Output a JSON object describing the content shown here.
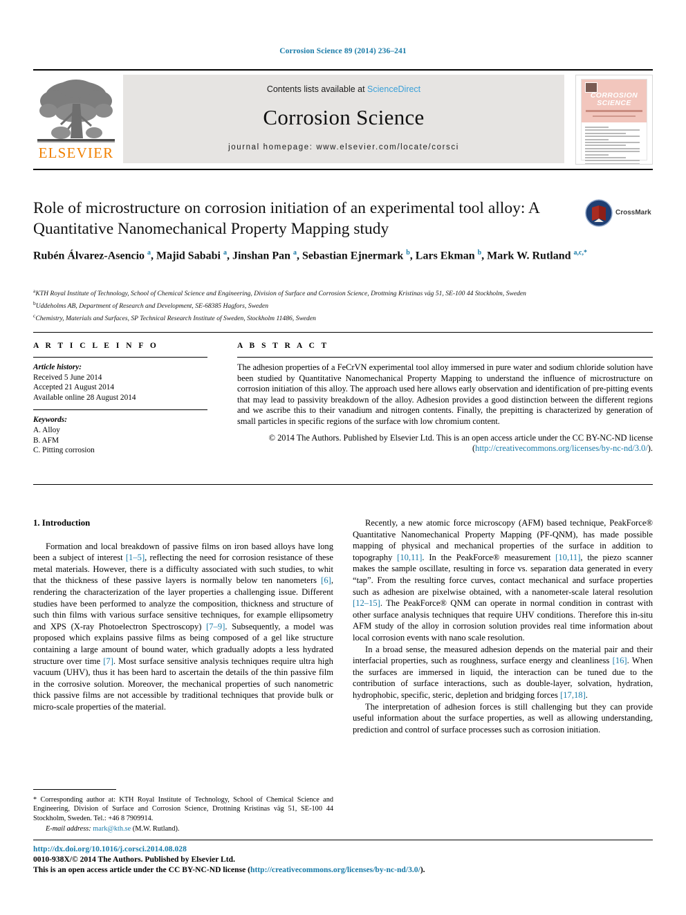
{
  "running_head": "Corrosion Science 89 (2014) 236–241",
  "masthead": {
    "publisher_logo_text": "ELSEVIER",
    "contents_prefix": "Contents lists available at ",
    "contents_link": "ScienceDirect",
    "journal_title": "Corrosion Science",
    "homepage_line": "journal homepage: www.elsevier.com/locate/corsci",
    "cover": {
      "title_line1": "CORROSION",
      "title_line2": "SCIENCE"
    }
  },
  "article": {
    "title": "Role of microstructure on corrosion initiation of an experimental tool alloy: A Quantitative Nanomechanical Property Mapping study",
    "crossmark_label": "CrossMark",
    "authors_html": "Rubén Álvarez-Asencio <sup>a</sup>, Majid Sababi <sup>a</sup>, Jinshan Pan <sup>a</sup>, Sebastian Ejnermark <sup>b</sup>, Lars Ekman <sup>b</sup>, Mark W. Rutland <sup>a,c,*</sup>",
    "affiliations": [
      {
        "marker": "a",
        "text": "KTH Royal Institute of Technology, School of Chemical Science and Engineering, Division of Surface and Corrosion Science, Drottning Kristinas väg 51, SE-100 44 Stockholm, Sweden"
      },
      {
        "marker": "b",
        "text": "Uddeholms AB, Department of Research and Development, SE-68385 Hagfors, Sweden"
      },
      {
        "marker": "c",
        "text": "Chemistry, Materials and Surfaces, SP Technical Research Institute of Sweden, Stockholm 11486, Sweden"
      }
    ]
  },
  "info": {
    "heading": "A R T I C L E   I N F O",
    "history_label": "Article history:",
    "history": [
      "Received 5 June 2014",
      "Accepted 21 August 2014",
      "Available online 28 August 2014"
    ],
    "keywords_label": "Keywords:",
    "keywords": [
      "A. Alloy",
      "B. AFM",
      "C. Pitting corrosion"
    ]
  },
  "abstract": {
    "heading": "A B S T R A C T",
    "text": "The adhesion properties of a FeCrVN experimental tool alloy immersed in pure water and sodium chloride solution have been studied by Quantitative Nanomechanical Property Mapping to understand the influence of microstructure on corrosion initiation of this alloy. The approach used here allows early observation and identification of pre-pitting events that may lead to passivity breakdown of the alloy. Adhesion provides a good distinction between the different regions and we ascribe this to their vanadium and nitrogen contents. Finally, the prepitting is characterized by generation of small particles in specific regions of the surface with low chromium content.",
    "copyright_prefix": "© 2014 The Authors. Published by Elsevier Ltd. This is an open access article under the CC BY-NC-ND license (",
    "copyright_link": "http://creativecommons.org/licenses/by-nc-nd/3.0/",
    "copyright_suffix": ")."
  },
  "body": {
    "section_heading": "1. Introduction",
    "left_paragraph": "Formation and local breakdown of passive films on iron based alloys have long been a subject of interest [1–5], reflecting the need for corrosion resistance of these metal materials. However, there is a difficulty associated with such studies, to whit that the thickness of these passive layers is normally below ten nanometers [6], rendering the characterization of the layer properties a challenging issue. Different studies have been performed to analyze the composition, thickness and structure of such thin films with various surface sensitive techniques, for example ellipsometry and XPS (X-ray Photoelectron Spectroscopy) [7–9]. Subsequently, a model was proposed which explains passive films as being composed of a gel like structure containing a large amount of bound water, which gradually adopts a less hydrated structure over time [7]. Most surface sensitive analysis techniques require ultra high vacuum (UHV), thus it has been hard to ascertain the details of the thin passive film in the corrosive solution. Moreover, the mechanical properties of such nanometric thick passive films are not accessible by traditional techniques that provide bulk or micro-scale properties of the material.",
    "right_paragraph_1": "Recently, a new atomic force microscopy (AFM) based technique, PeakForce® Quantitative Nanomechanical Property Mapping (PF-QNM), has made possible mapping of physical and mechanical properties of the surface in addition to topography [10,11]. In the PeakForce® measurement [10,11], the piezo scanner makes the sample oscillate, resulting in force vs. separation data generated in every “tap”. From the resulting force curves, contact mechanical and surface properties such as adhesion are pixelwise obtained, with a nanometer-scale lateral resolution [12–15]. The PeakForce® QNM can operate in normal condition in contrast with other surface analysis techniques that require UHV conditions. Therefore this in-situ AFM study of the alloy in corrosion solution provides real time information about local corrosion events with nano scale resolution.",
    "right_paragraph_2": "In a broad sense, the measured adhesion depends on the material pair and their interfacial properties, such as roughness, surface energy and cleanliness [16]. When the surfaces are immersed in liquid, the interaction can be tuned due to the contribution of surface interactions, such as double-layer, solvation, hydration, hydrophobic, specific, steric, depletion and bridging forces [17,18].",
    "right_paragraph_3": "The interpretation of adhesion forces is still challenging but they can provide useful information about the surface properties, as well as allowing understanding, prediction and control of surface processes such as corrosion initiation."
  },
  "footnote": {
    "corresponding": "* Corresponding author at: KTH Royal Institute of Technology, School of Chemical Science and Engineering, Division of Surface and Corrosion Science, Drottning Kristinas väg 51, SE-100 44 Stockholm, Sweden. Tel.: +46 8 7909914.",
    "email_label": "E-mail address:",
    "email": "mark@kth.se",
    "email_owner": "(M.W. Rutland)."
  },
  "footer": {
    "doi": "http://dx.doi.org/10.1016/j.corsci.2014.08.028",
    "issn_line": "0010-938X/© 2014 The Authors. Published by Elsevier Ltd.",
    "license_prefix": "This is an open access article under the CC BY-NC-ND license (",
    "license_link": "http://creativecommons.org/licenses/by-nc-nd/3.0/",
    "license_suffix": ")."
  },
  "colors": {
    "link": "#1a7ba8",
    "elsevier_orange": "#F08000",
    "masthead_gray": "#e6e4e2",
    "cover_band": "#f2c6bd"
  }
}
